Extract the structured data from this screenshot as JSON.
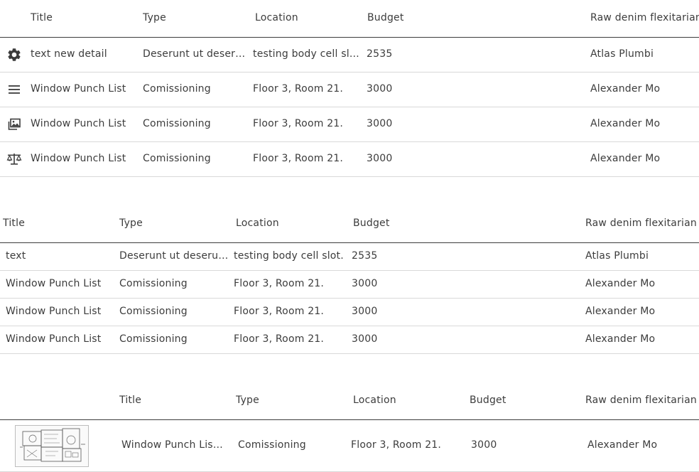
{
  "table1": {
    "columns": [
      "Title",
      "Type",
      "Location",
      "Budget",
      "Raw denim flexitarian gr"
    ],
    "rows": [
      {
        "icon": "gear-icon",
        "title": "text new detail",
        "type": "Deserunt ut deserunt",
        "location": "testing body cell slot.",
        "budget": "2535",
        "extra": "Atlas Plumbi"
      },
      {
        "icon": "hamburger-menu-icon",
        "title": "Window Punch List",
        "type": "Comissioning",
        "location": "Floor 3, Room 21.",
        "budget": "3000",
        "extra": "Alexander Mo"
      },
      {
        "icon": "image-gallery-icon",
        "title": "Window Punch List",
        "type": "Comissioning",
        "location": "Floor 3, Room 21.",
        "budget": "3000",
        "extra": "Alexander Mo"
      },
      {
        "icon": "balance-scale-icon",
        "title": "Window Punch List",
        "type": "Comissioning",
        "location": "Floor 3, Room 21.",
        "budget": "3000",
        "extra": "Alexander Mo"
      }
    ]
  },
  "table2": {
    "columns": [
      "Title",
      "Type",
      "Location",
      "Budget",
      "Raw denim flexitarian gr"
    ],
    "rows": [
      {
        "title": "text",
        "type": "Deserunt ut deserunt deserunt",
        "location": "testing body cell slot.",
        "budget": "2535",
        "extra": "Atlas Plumbi"
      },
      {
        "title": "Window Punch List",
        "type": "Comissioning",
        "location": "Floor 3, Room 21.",
        "budget": "3000",
        "extra": "Alexander Mo"
      },
      {
        "title": "Window Punch List",
        "type": "Comissioning",
        "location": "Floor 3, Room 21.",
        "budget": "3000",
        "extra": "Alexander Mo"
      },
      {
        "title": "Window Punch List",
        "type": "Comissioning",
        "location": "Floor 3, Room 21.",
        "budget": "3000",
        "extra": "Alexander Mo"
      }
    ]
  },
  "table3": {
    "columns": [
      "Title",
      "Type",
      "Location",
      "Budget",
      "Raw denim flexitarian gr"
    ],
    "rows": [
      {
        "thumbnail": "floor-plan-thumbnail",
        "title": "Window Punch List title",
        "type": "Comissioning",
        "location": "Floor 3, Room 21.",
        "budget": "3000",
        "extra": "Alexander Mo"
      }
    ]
  },
  "colors": {
    "text": "#3c3c3c",
    "header_rule": "#3c3c3c",
    "row_rule": "#d9d9d9",
    "icon": "#3c3c3c"
  }
}
